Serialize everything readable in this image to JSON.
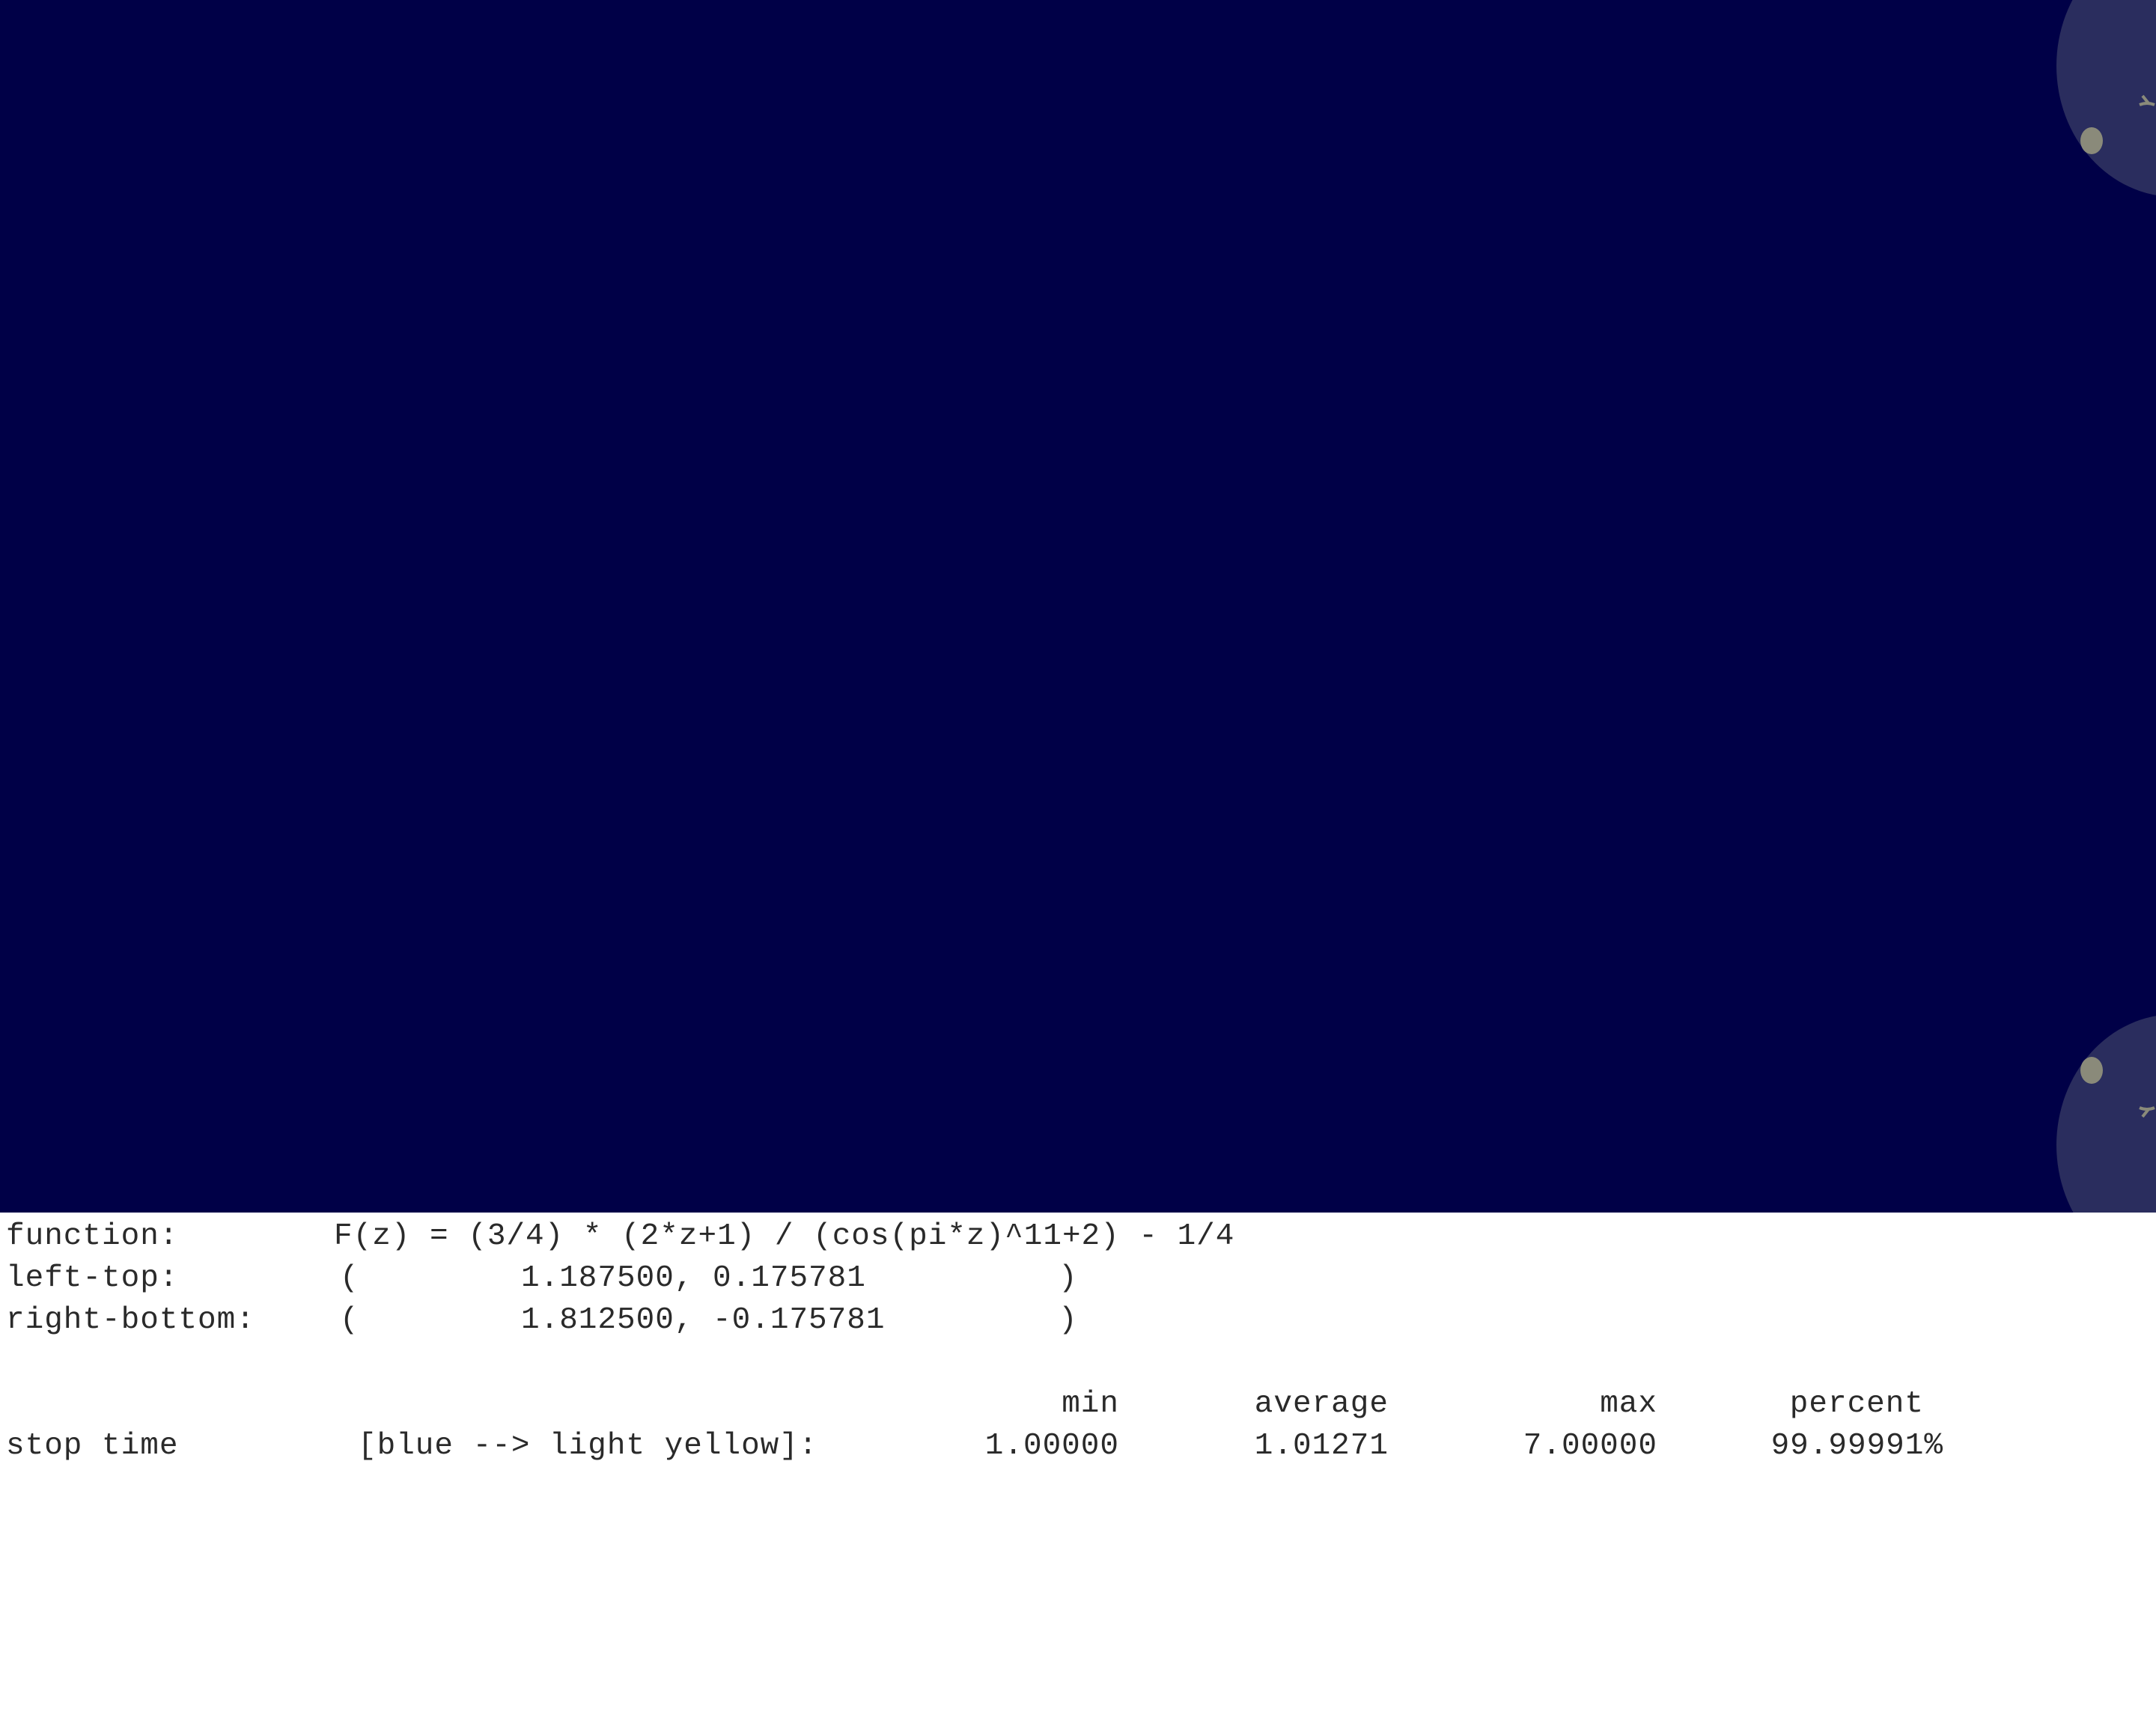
{
  "plot": {
    "background_color": "#000047",
    "blob_color": "#2a2d5e",
    "detail_color": "#8a8a7a"
  },
  "info": {
    "function_label": "function:",
    "function_value": "F(z) = (3/4) * (2*z+1) / (cos(pi*z)^11+2) - 1/4",
    "left_top_label": "left-top:",
    "left_top_open": "(",
    "left_top_value": "1.187500, 0.175781",
    "left_top_close": ")",
    "right_bottom_label": "right-bottom:",
    "right_bottom_open": "(",
    "right_bottom_value": "1.812500, -0.175781",
    "right_bottom_close": ")"
  },
  "stats": {
    "headers": {
      "min": "min",
      "average": "average",
      "max": "max",
      "percent": "percent"
    },
    "row": {
      "label": "stop time",
      "legend": "[blue --> light yellow]:",
      "min": "1.00000",
      "average": "1.01271",
      "max": "7.00000",
      "percent": "99.99991%"
    }
  }
}
